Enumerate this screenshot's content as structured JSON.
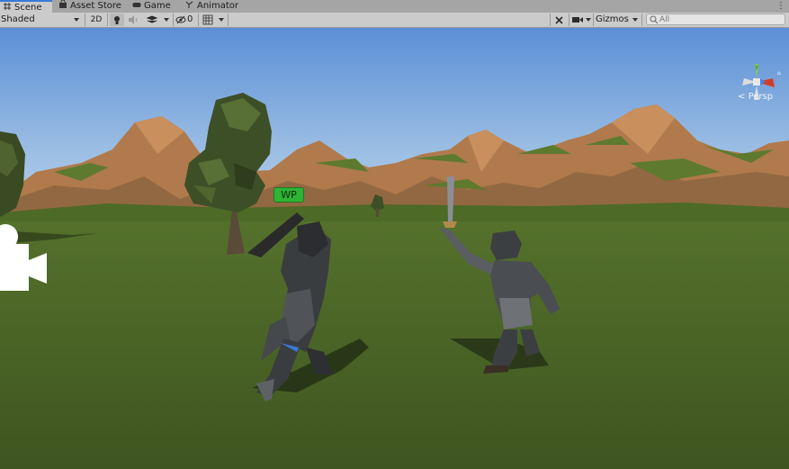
{
  "tabs": [
    {
      "label": "Scene",
      "icon": "scene-hash-icon",
      "active": true
    },
    {
      "label": "Asset Store",
      "icon": "store-bag-icon",
      "active": false
    },
    {
      "label": "Game",
      "icon": "gamepad-icon",
      "active": false
    },
    {
      "label": "Animator",
      "icon": "animator-icon",
      "active": false
    }
  ],
  "toolbar": {
    "draw_mode": "Shaded",
    "mode_2d": "2D",
    "hidden_count": "0",
    "gizmos_label": "Gizmos",
    "search_placeholder": "All"
  },
  "scene": {
    "view_mode_label": "Persp",
    "waypoint_label": "WP",
    "colors": {
      "sky_top": "#5b8fd6",
      "sky_bottom": "#c2d8ea",
      "ground": "#4a6326",
      "mountain": "#b07a4c",
      "mountain_grass": "#5d7a2e",
      "selection_blue": "#3a79d8"
    }
  }
}
